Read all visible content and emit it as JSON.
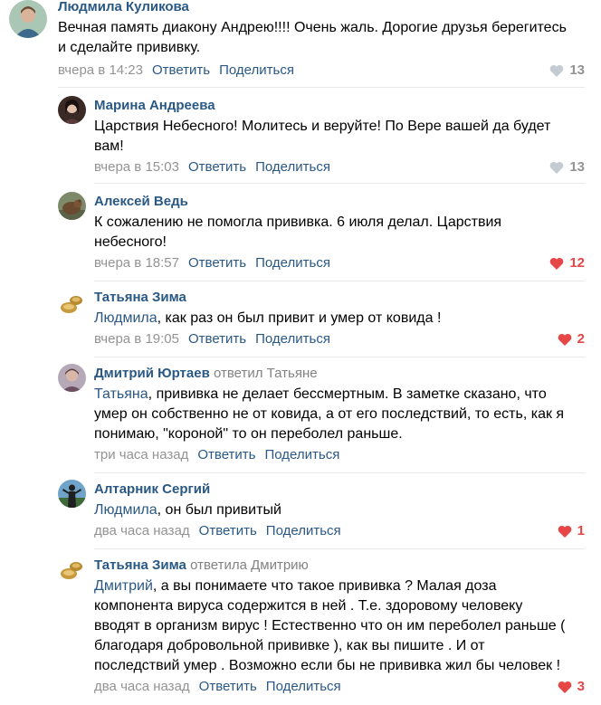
{
  "comments": [
    {
      "author": "Людмила Куликова",
      "lines": [
        "Вечная память диакону Андрею!!!! Очень жаль. Дорогие друзья берегитесь",
        "и сделайте прививку."
      ],
      "time": "вчера в 14:23",
      "reply": "Ответить",
      "share": "Поделиться",
      "likes": "13",
      "liked": false
    },
    {
      "author": "Марина Андреева",
      "lines": [
        "Царствия Небесного! Молитесь и веруйте! По Вере вашей да будет",
        "вам!"
      ],
      "time": "вчера в 15:03",
      "reply": "Ответить",
      "share": "Поделиться",
      "likes": "13",
      "liked": false
    },
    {
      "author": "Алексей Ведь",
      "lines": [
        "К сожалению не помогла прививка. 6 июля делал. Царствия",
        "небесного!"
      ],
      "time": "вчера в 18:57",
      "reply": "Ответить",
      "share": "Поделиться",
      "likes": "12",
      "liked": true
    },
    {
      "author": "Татьяна Зима",
      "mention": "Людмила",
      "lines": [
        ", как раз он был привит и умер от ковида !"
      ],
      "time": "вчера в 19:05",
      "reply": "Ответить",
      "share": "Поделиться",
      "likes": "2",
      "liked": true
    },
    {
      "author": "Дмитрий Юртаев",
      "replied_to": "ответил Татьяне",
      "mention": "Татьяна",
      "lines": [
        ", прививка не делает бессмертным. В заметке сказано, что",
        "умер он собственно не от ковида, а от его последствий, то есть, как я",
        "понимаю, \"короной\" то он переболел раньше."
      ],
      "time": "три часа назад",
      "reply": "Ответить",
      "share": "Поделиться"
    },
    {
      "author": "Алтарник Сергий",
      "mention": "Людмила",
      "lines": [
        ", он был привитый"
      ],
      "time": "два часа назад",
      "reply": "Ответить",
      "share": "Поделиться",
      "likes": "1",
      "liked": true
    },
    {
      "author": "Татьяна Зима",
      "replied_to": "ответила Дмитрию",
      "mention": "Дмитрий",
      "lines": [
        ", а вы понимаете что такое прививка ? Малая доза",
        "компонента вируса содержится в ней . Т.е. здоровому человеку",
        "вводят в организм вирус ! Естественно что он им переболел раньше (",
        "благодаря добровольной прививке ), как вы пишите . И от",
        "последствий умер . Возможно если бы не прививка жил бы человек !"
      ],
      "time": "два часа назад",
      "reply": "Ответить",
      "share": "Поделиться",
      "likes": "3",
      "liked": true
    }
  ]
}
